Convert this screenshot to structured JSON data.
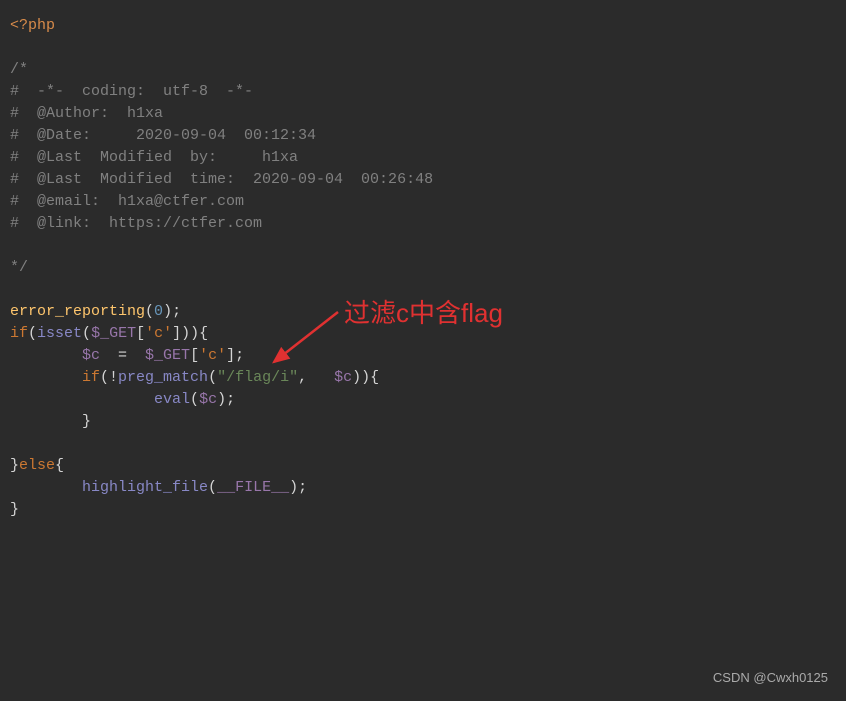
{
  "code": {
    "php_open": "<?php",
    "comment_open": "/*",
    "comment_l1": "#  -*-  coding:  utf-8  -*-",
    "comment_l2": "#  @Author:  h1xa",
    "comment_l3": "#  @Date:     2020-09-04  00:12:34",
    "comment_l4": "#  @Last  Modified  by:     h1xa",
    "comment_l5": "#  @Last  Modified  time:  2020-09-04  00:26:48",
    "comment_l6": "#  @email:  h1xa@ctfer.com",
    "comment_l7": "#  @link:  https://ctfer.com",
    "comment_close": "*/",
    "error_reporting": "error_reporting",
    "zero": "0",
    "if": "if",
    "isset": "isset",
    "get": "$_GET",
    "c_key": "'c'",
    "c_var": "$c",
    "equals": "  =  ",
    "preg_match": "preg_match",
    "flag_regex": "\"/flag/i\"",
    "eval": "eval",
    "else": "else",
    "highlight_file": "highlight_file",
    "file_const": "__FILE__"
  },
  "annotation": {
    "text": "过滤c中含flag"
  },
  "watermark": {
    "text": "CSDN @Cwxh0125"
  }
}
